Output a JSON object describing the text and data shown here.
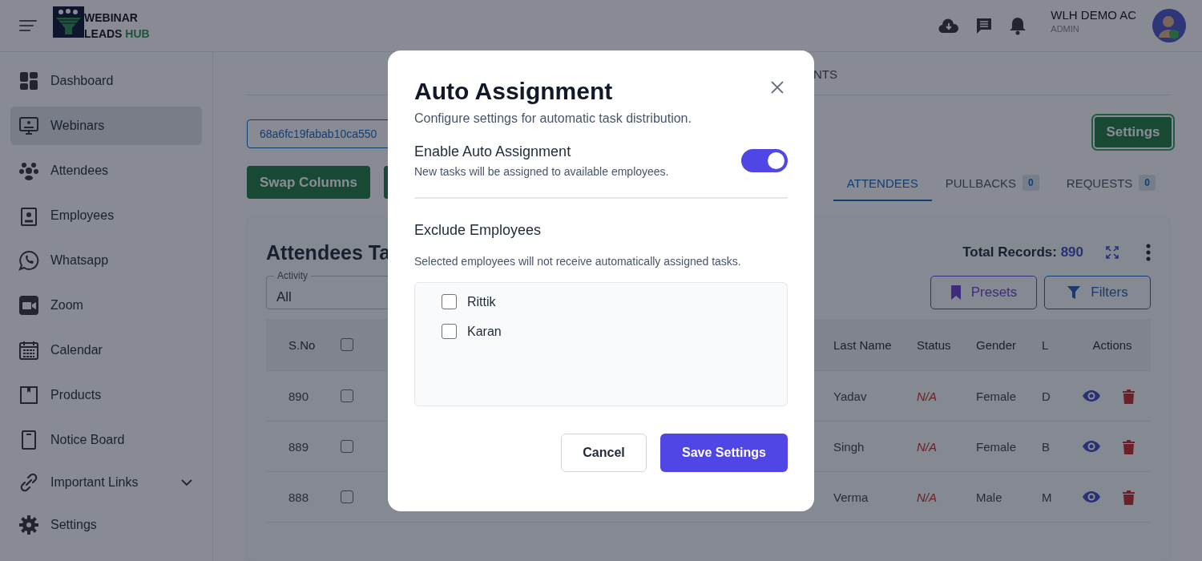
{
  "header": {
    "logo": {
      "line1": "WEBINAR",
      "line2": "LEADS",
      "line2_accent": "HUB"
    },
    "user": {
      "name": "WLH DEMO AC",
      "role": "ADMIN"
    }
  },
  "sidebar": {
    "items": [
      {
        "label": "Dashboard",
        "selected": false
      },
      {
        "label": "Webinars",
        "selected": true
      },
      {
        "label": "Attendees",
        "selected": false
      },
      {
        "label": "Employees",
        "selected": false
      },
      {
        "label": "Whatsapp",
        "selected": false
      },
      {
        "label": "Zoom",
        "selected": false
      },
      {
        "label": "Calendar",
        "selected": false
      },
      {
        "label": "Products",
        "selected": false
      },
      {
        "label": "Notice Board",
        "selected": false
      },
      {
        "label": "Important Links",
        "selected": false,
        "expanded": false
      },
      {
        "label": "Settings",
        "selected": false
      }
    ]
  },
  "main": {
    "tab_fragment": "NTS",
    "webinar_id": "68a6fc19fabab10ca550",
    "settings_button": "Settings",
    "swap_button": "Swap Columns",
    "tabs": [
      {
        "label": "ATTENDEES",
        "selected": true
      },
      {
        "label": "PULLBACKS",
        "selected": false,
        "count": "0"
      },
      {
        "label": "REQUESTS",
        "selected": false,
        "count": "0"
      }
    ],
    "card": {
      "title": "Attendees Ta",
      "total_label": "Total Records:",
      "total_value": "890",
      "activity": {
        "label": "Activity",
        "value": "All"
      },
      "presets_button": "Presets",
      "filters_button": "Filters",
      "table": {
        "columns_left": [
          "S.No"
        ],
        "header_checked": false,
        "columns_right": [
          "Last Name",
          "Status",
          "Gender",
          "L",
          "Actions"
        ],
        "rows": [
          {
            "sno": "890",
            "checked": false,
            "last_name": "Yadav",
            "status": "N/A",
            "gender": "Female",
            "column_l": "D"
          },
          {
            "sno": "889",
            "checked": false,
            "last_name": "Singh",
            "status": "N/A",
            "gender": "Female",
            "column_l": "B"
          },
          {
            "sno": "888",
            "checked": false,
            "last_name": "Verma",
            "status": "N/A",
            "gender": "Male",
            "column_l": "M"
          }
        ]
      }
    }
  },
  "modal": {
    "title": "Auto Assignment",
    "subtitle": "Configure settings for automatic task distribution.",
    "toggle": {
      "label": "Enable Auto Assignment",
      "hint": "New tasks will be assigned to available employees.",
      "on": true
    },
    "exclude": {
      "title": "Exclude Employees",
      "hint": "Selected employees will not receive automatically assigned tasks.",
      "employees": [
        {
          "name": "Rittik",
          "checked": false
        },
        {
          "name": "Karan",
          "checked": false
        }
      ]
    },
    "cancel_button": "Cancel",
    "save_button": "Save Settings"
  }
}
